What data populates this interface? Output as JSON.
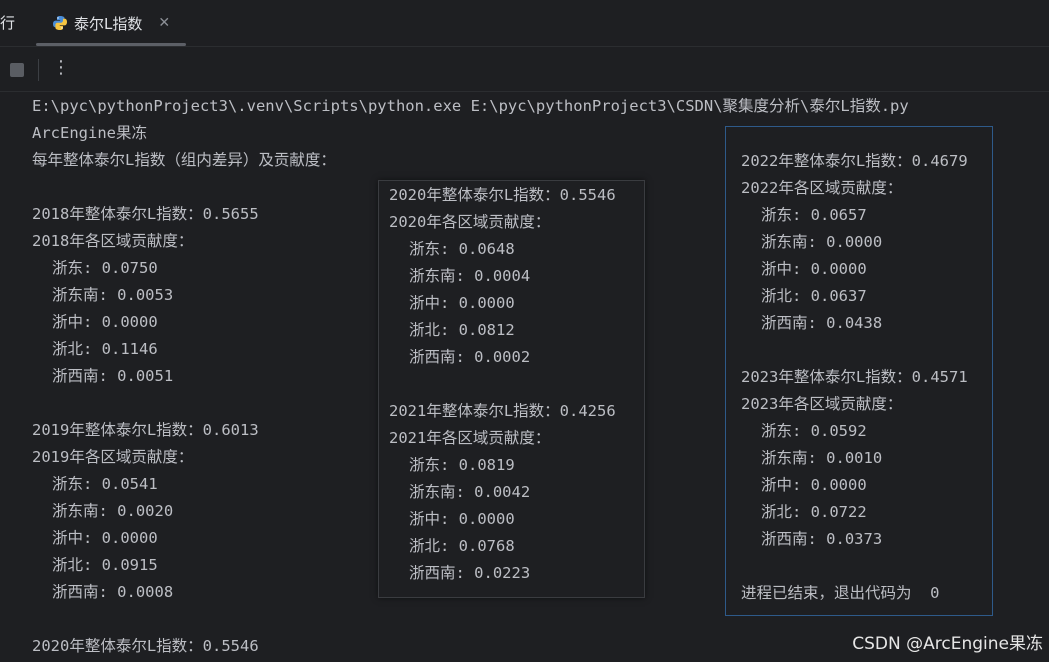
{
  "tabs": {
    "prev_label": "行",
    "active_label": "泰尔L指数"
  },
  "console": {
    "command": "E:\\pyc\\pythonProject3\\.venv\\Scripts\\python.exe E:\\pyc\\pythonProject3\\CSDN\\聚集度分析\\泰尔L指数.py",
    "author": "ArcEngine果冻",
    "header": "每年整体泰尔L指数（组内差异）及贡献度：",
    "left_blocks": [
      {
        "overall": "2018年整体泰尔L指数：0.5655",
        "contrib_title": "2018年各区域贡献度：",
        "items": [
          "浙东: 0.0750",
          "浙东南: 0.0053",
          "浙中: 0.0000",
          "浙北: 0.1146",
          "浙西南: 0.0051"
        ]
      },
      {
        "overall": "2019年整体泰尔L指数：0.6013",
        "contrib_title": "2019年各区域贡献度：",
        "items": [
          "浙东: 0.0541",
          "浙东南: 0.0020",
          "浙中: 0.0000",
          "浙北: 0.0915",
          "浙西南: 0.0008"
        ]
      }
    ],
    "left_tail": "2020年整体泰尔L指数：0.5546",
    "mid_blocks": [
      {
        "overall": "2020年整体泰尔L指数：0.5546",
        "contrib_title": "2020年各区域贡献度：",
        "items": [
          "浙东: 0.0648",
          "浙东南: 0.0004",
          "浙中: 0.0000",
          "浙北: 0.0812",
          "浙西南: 0.0002"
        ]
      },
      {
        "overall": "2021年整体泰尔L指数：0.4256",
        "contrib_title": "2021年各区域贡献度：",
        "items": [
          "浙东: 0.0819",
          "浙东南: 0.0042",
          "浙中: 0.0000",
          "浙北: 0.0768",
          "浙西南: 0.0223"
        ]
      }
    ],
    "right_blocks": [
      {
        "overall": "2022年整体泰尔L指数：0.4679",
        "contrib_title": "2022年各区域贡献度：",
        "items": [
          "浙东: 0.0657",
          "浙东南: 0.0000",
          "浙中: 0.0000",
          "浙北: 0.0637",
          "浙西南: 0.0438"
        ]
      },
      {
        "overall": "2023年整体泰尔L指数：0.4571",
        "contrib_title": "2023年各区域贡献度：",
        "items": [
          "浙东: 0.0592",
          "浙东南: 0.0010",
          "浙中: 0.0000",
          "浙北: 0.0722",
          "浙西南: 0.0373"
        ]
      }
    ],
    "exit_message": "进程已结束，退出代码为  0"
  },
  "watermark": "CSDN @ArcEngine果冻",
  "icons": {
    "tab_icon": "python-icon",
    "stop": "stop-icon",
    "more": "more-vertical-icon",
    "close": "close-icon"
  }
}
